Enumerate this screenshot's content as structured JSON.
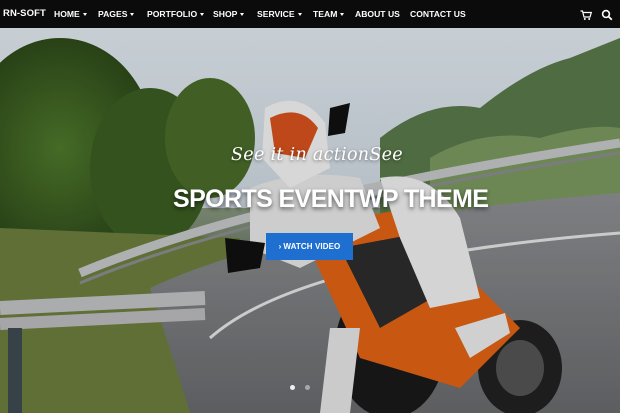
{
  "brand": {
    "name": "RN-SOFT"
  },
  "nav": {
    "items": [
      {
        "label": "HOME",
        "dropdown": true
      },
      {
        "label": "PAGES",
        "dropdown": true
      },
      {
        "label": "PORTFOLIO",
        "dropdown": true
      },
      {
        "label": "SHOP",
        "dropdown": true
      },
      {
        "label": "SERVICE",
        "dropdown": true
      },
      {
        "label": "TEAM",
        "dropdown": true
      },
      {
        "label": "ABOUT US",
        "dropdown": false
      },
      {
        "label": "CONTACT US",
        "dropdown": false
      }
    ],
    "icons": [
      "cart-icon",
      "search-icon"
    ]
  },
  "hero": {
    "tagline": "See it in actionSee",
    "headline": "SPORTS EVENTWP THEME",
    "button_label": "WATCH VIDEO",
    "slides": 2,
    "active_slide": 1
  },
  "colors": {
    "navbar": "#0b0b0b",
    "button": "#1f6fd0",
    "text": "#ffffff"
  }
}
